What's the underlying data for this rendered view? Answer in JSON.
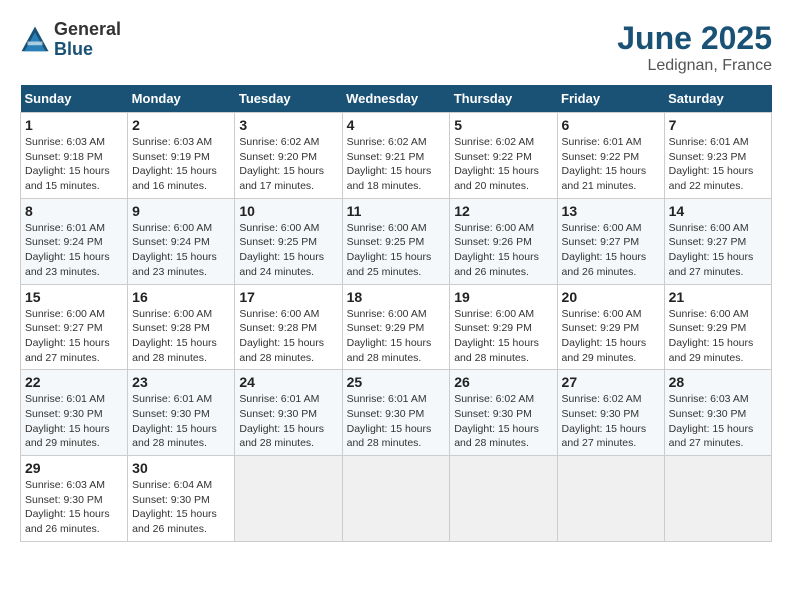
{
  "logo": {
    "general": "General",
    "blue": "Blue"
  },
  "title": {
    "month": "June 2025",
    "location": "Ledignan, France"
  },
  "weekdays": [
    "Sunday",
    "Monday",
    "Tuesday",
    "Wednesday",
    "Thursday",
    "Friday",
    "Saturday"
  ],
  "weeks": [
    [
      {
        "day": "1",
        "info": "Sunrise: 6:03 AM\nSunset: 9:18 PM\nDaylight: 15 hours\nand 15 minutes."
      },
      {
        "day": "2",
        "info": "Sunrise: 6:03 AM\nSunset: 9:19 PM\nDaylight: 15 hours\nand 16 minutes."
      },
      {
        "day": "3",
        "info": "Sunrise: 6:02 AM\nSunset: 9:20 PM\nDaylight: 15 hours\nand 17 minutes."
      },
      {
        "day": "4",
        "info": "Sunrise: 6:02 AM\nSunset: 9:21 PM\nDaylight: 15 hours\nand 18 minutes."
      },
      {
        "day": "5",
        "info": "Sunrise: 6:02 AM\nSunset: 9:22 PM\nDaylight: 15 hours\nand 20 minutes."
      },
      {
        "day": "6",
        "info": "Sunrise: 6:01 AM\nSunset: 9:22 PM\nDaylight: 15 hours\nand 21 minutes."
      },
      {
        "day": "7",
        "info": "Sunrise: 6:01 AM\nSunset: 9:23 PM\nDaylight: 15 hours\nand 22 minutes."
      }
    ],
    [
      {
        "day": "8",
        "info": "Sunrise: 6:01 AM\nSunset: 9:24 PM\nDaylight: 15 hours\nand 23 minutes."
      },
      {
        "day": "9",
        "info": "Sunrise: 6:00 AM\nSunset: 9:24 PM\nDaylight: 15 hours\nand 23 minutes."
      },
      {
        "day": "10",
        "info": "Sunrise: 6:00 AM\nSunset: 9:25 PM\nDaylight: 15 hours\nand 24 minutes."
      },
      {
        "day": "11",
        "info": "Sunrise: 6:00 AM\nSunset: 9:25 PM\nDaylight: 15 hours\nand 25 minutes."
      },
      {
        "day": "12",
        "info": "Sunrise: 6:00 AM\nSunset: 9:26 PM\nDaylight: 15 hours\nand 26 minutes."
      },
      {
        "day": "13",
        "info": "Sunrise: 6:00 AM\nSunset: 9:27 PM\nDaylight: 15 hours\nand 26 minutes."
      },
      {
        "day": "14",
        "info": "Sunrise: 6:00 AM\nSunset: 9:27 PM\nDaylight: 15 hours\nand 27 minutes."
      }
    ],
    [
      {
        "day": "15",
        "info": "Sunrise: 6:00 AM\nSunset: 9:27 PM\nDaylight: 15 hours\nand 27 minutes."
      },
      {
        "day": "16",
        "info": "Sunrise: 6:00 AM\nSunset: 9:28 PM\nDaylight: 15 hours\nand 28 minutes."
      },
      {
        "day": "17",
        "info": "Sunrise: 6:00 AM\nSunset: 9:28 PM\nDaylight: 15 hours\nand 28 minutes."
      },
      {
        "day": "18",
        "info": "Sunrise: 6:00 AM\nSunset: 9:29 PM\nDaylight: 15 hours\nand 28 minutes."
      },
      {
        "day": "19",
        "info": "Sunrise: 6:00 AM\nSunset: 9:29 PM\nDaylight: 15 hours\nand 28 minutes."
      },
      {
        "day": "20",
        "info": "Sunrise: 6:00 AM\nSunset: 9:29 PM\nDaylight: 15 hours\nand 29 minutes."
      },
      {
        "day": "21",
        "info": "Sunrise: 6:00 AM\nSunset: 9:29 PM\nDaylight: 15 hours\nand 29 minutes."
      }
    ],
    [
      {
        "day": "22",
        "info": "Sunrise: 6:01 AM\nSunset: 9:30 PM\nDaylight: 15 hours\nand 29 minutes."
      },
      {
        "day": "23",
        "info": "Sunrise: 6:01 AM\nSunset: 9:30 PM\nDaylight: 15 hours\nand 28 minutes."
      },
      {
        "day": "24",
        "info": "Sunrise: 6:01 AM\nSunset: 9:30 PM\nDaylight: 15 hours\nand 28 minutes."
      },
      {
        "day": "25",
        "info": "Sunrise: 6:01 AM\nSunset: 9:30 PM\nDaylight: 15 hours\nand 28 minutes."
      },
      {
        "day": "26",
        "info": "Sunrise: 6:02 AM\nSunset: 9:30 PM\nDaylight: 15 hours\nand 28 minutes."
      },
      {
        "day": "27",
        "info": "Sunrise: 6:02 AM\nSunset: 9:30 PM\nDaylight: 15 hours\nand 27 minutes."
      },
      {
        "day": "28",
        "info": "Sunrise: 6:03 AM\nSunset: 9:30 PM\nDaylight: 15 hours\nand 27 minutes."
      }
    ],
    [
      {
        "day": "29",
        "info": "Sunrise: 6:03 AM\nSunset: 9:30 PM\nDaylight: 15 hours\nand 26 minutes."
      },
      {
        "day": "30",
        "info": "Sunrise: 6:04 AM\nSunset: 9:30 PM\nDaylight: 15 hours\nand 26 minutes."
      },
      null,
      null,
      null,
      null,
      null
    ]
  ]
}
